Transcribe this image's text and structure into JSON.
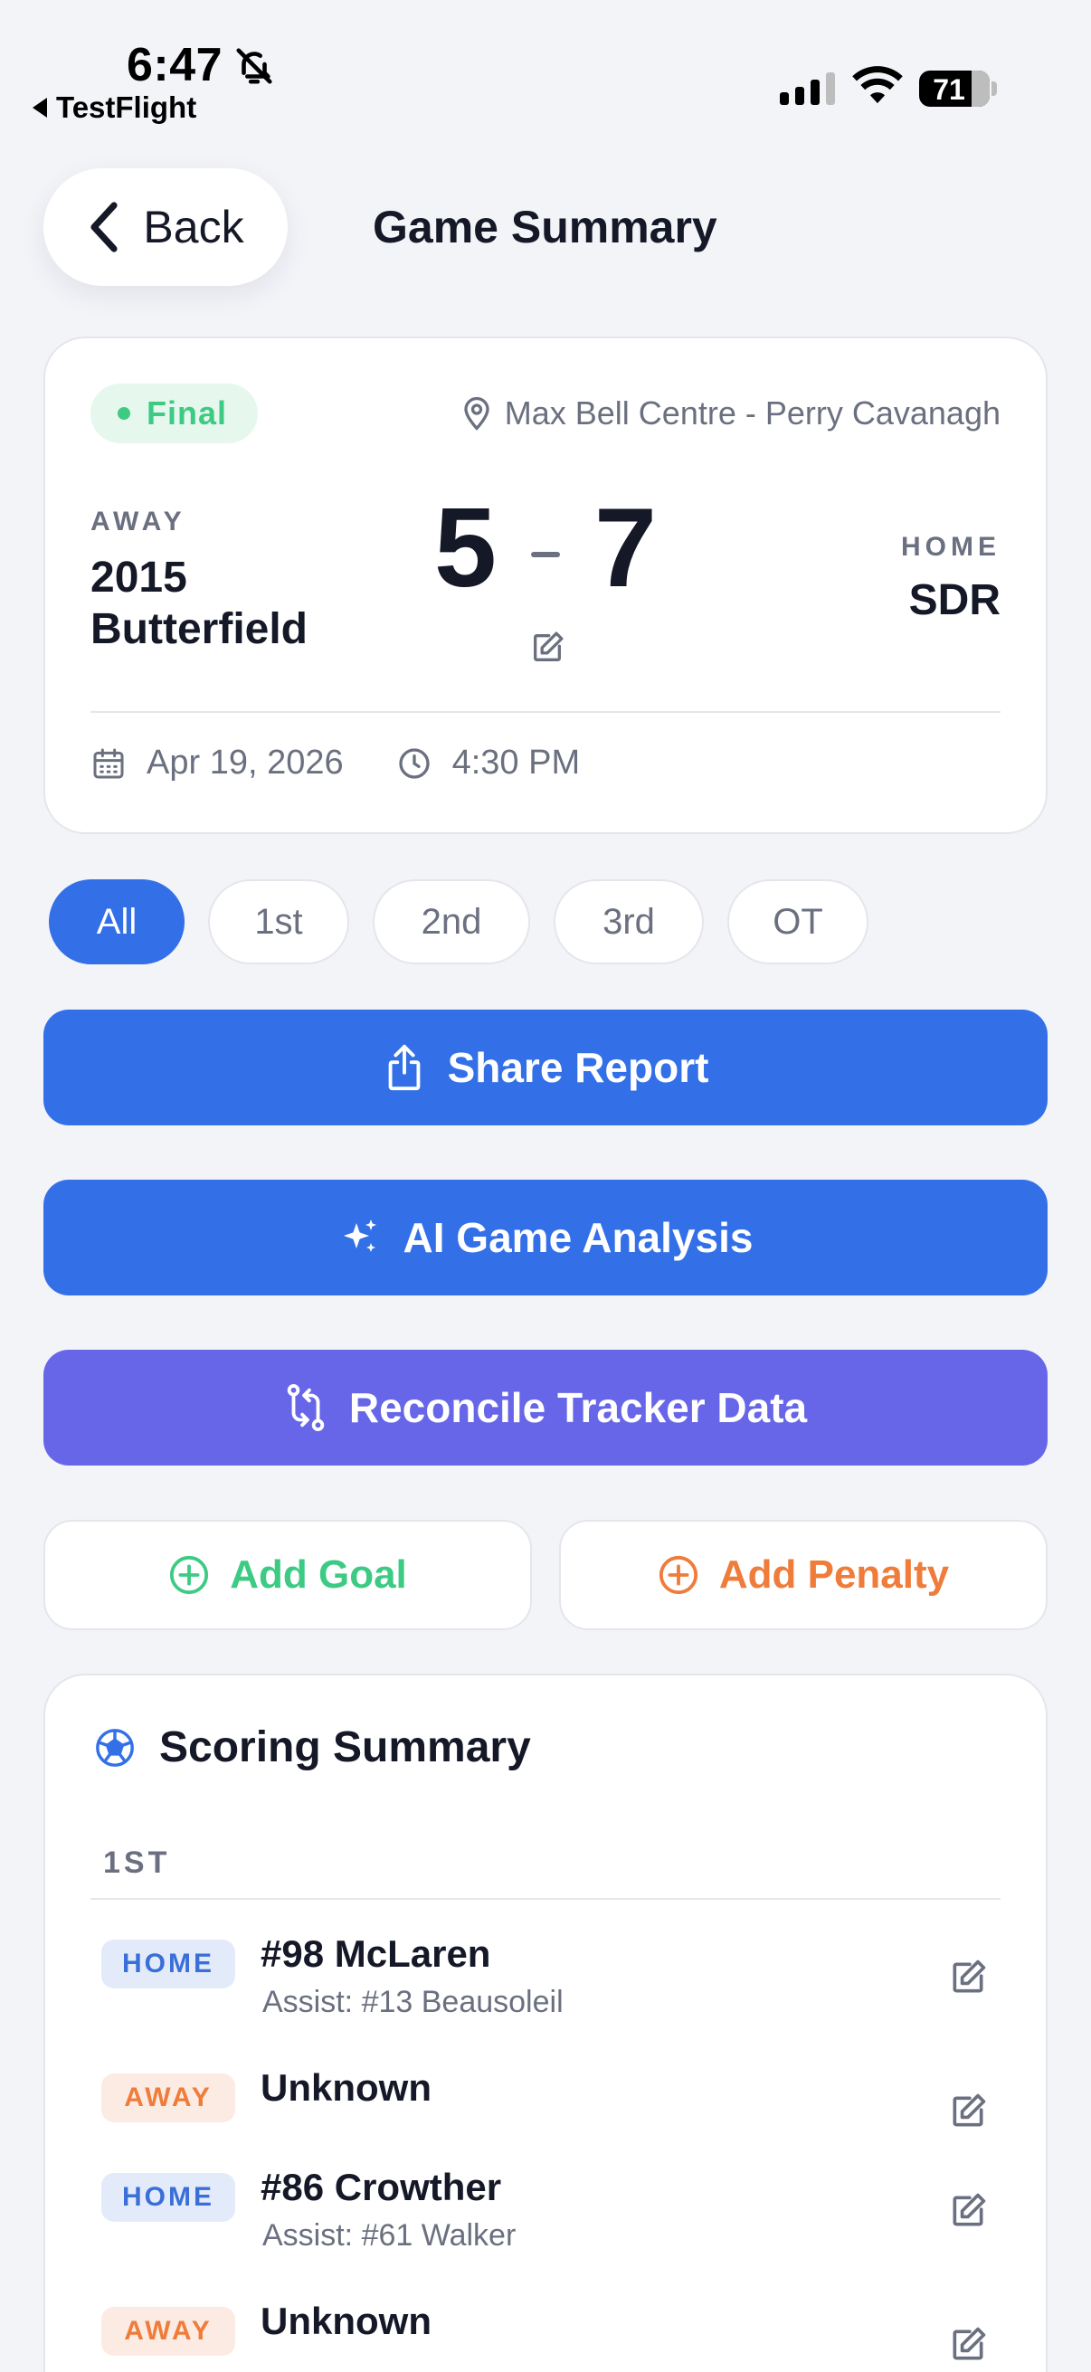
{
  "status_bar": {
    "time": "6:47",
    "back_app": "TestFlight",
    "battery": "71"
  },
  "header": {
    "back_label": "Back",
    "title": "Game Summary"
  },
  "game": {
    "status": "Final",
    "venue": "Max Bell Centre - Perry Cavanagh",
    "away": {
      "label": "AWAY",
      "name": "2015 Butterfield",
      "score": "5"
    },
    "home": {
      "label": "HOME",
      "name": "SDR",
      "score": "7"
    },
    "date": "Apr 19, 2026",
    "time": "4:30 PM"
  },
  "periods": [
    "All",
    "1st",
    "2nd",
    "3rd",
    "OT"
  ],
  "selected_period": "All",
  "actions": {
    "share": "Share Report",
    "ai": "AI Game Analysis",
    "reconcile": "Reconcile Tracker Data",
    "add_goal": "Add Goal",
    "add_penalty": "Add Penalty"
  },
  "scoring_summary": {
    "title": "Scoring Summary",
    "period_label": "1ST",
    "goals": [
      {
        "team": "HOME",
        "scorer": "#98 McLaren",
        "assist": "Assist: #13 Beausoleil"
      },
      {
        "team": "AWAY",
        "scorer": "Unknown",
        "assist": ""
      },
      {
        "team": "HOME",
        "scorer": "#86 Crowther",
        "assist": "Assist: #61 Walker"
      },
      {
        "team": "AWAY",
        "scorer": "Unknown",
        "assist": ""
      }
    ]
  },
  "colors": {
    "background": "#F3F4F8",
    "primary_blue": "#3370E8",
    "purple": "#6766E8",
    "green": "#3DCB84",
    "orange": "#EF7C3A",
    "text_dark": "#151827",
    "text_muted": "#6B7080"
  },
  "icons": {
    "status_bar": [
      "bell-slash-icon",
      "signal-icon",
      "wifi-icon",
      "battery-icon"
    ],
    "header": [
      "chevron-left-icon"
    ],
    "card": [
      "location-pin-icon",
      "edit-icon",
      "calendar-icon",
      "clock-icon"
    ],
    "actions": [
      "share-icon",
      "sparkles-icon",
      "reconcile-arrows-icon",
      "plus-circle-icon"
    ],
    "scoring": [
      "hockey-puck-icon",
      "edit-icon"
    ]
  }
}
